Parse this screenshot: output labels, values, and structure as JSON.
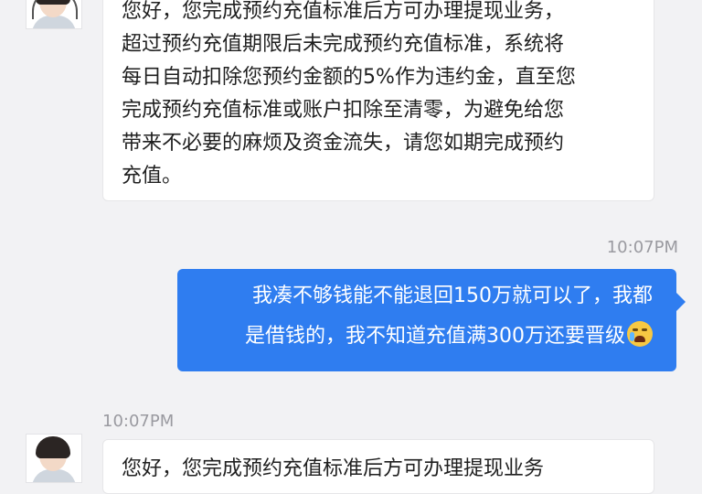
{
  "messages": [
    {
      "side": "left",
      "text": "您好，您完成预约充值标准后方可办理提现业务，\n超过预约充值期限后未完成预约充值标准，系统将\n每日自动扣除您预约金额的5%作为违约金，直至您\n完成预约充值标准或账户扣除至清零，为避免给您\n带来不必要的麻烦及资金流失，请您如期完成预约\n充值。"
    },
    {
      "side": "right",
      "timestamp": "10:07PM",
      "text": "我凑不够钱能不能退回150万就可以了，我都\n是借钱的，我不知道充值满300万还要晋级",
      "emoji": "crying-face"
    },
    {
      "side": "left",
      "timestamp": "10:07PM",
      "text": "您好，您完成预约充值标准后方可办理提现业务"
    }
  ],
  "colors": {
    "background": "#f2f2f4",
    "outgoing_bubble": "#2f7df0",
    "incoming_bubble": "#ffffff",
    "timestamp": "#9a9aa0"
  }
}
